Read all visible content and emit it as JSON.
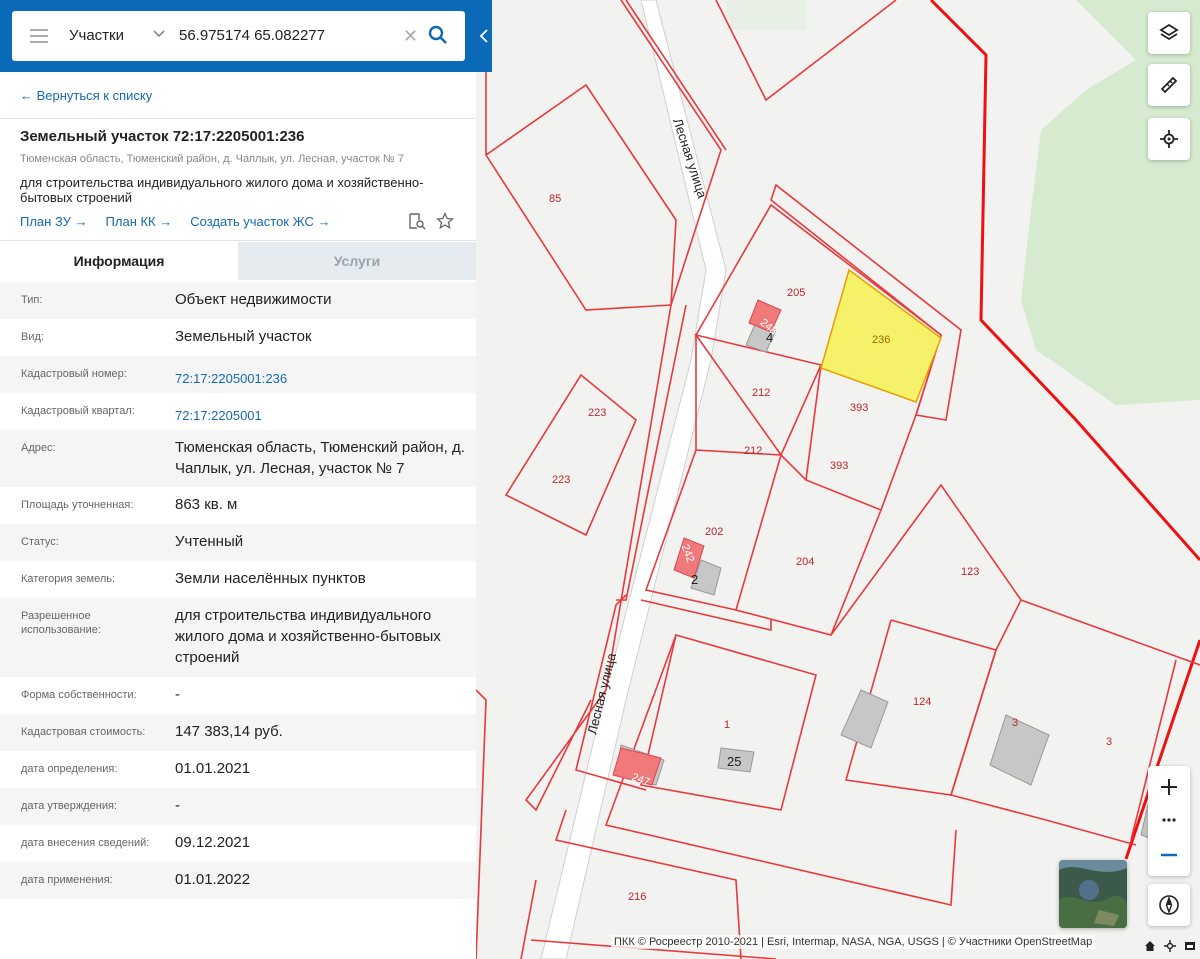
{
  "search": {
    "type_label": "Участки",
    "query": "56.975174 65.082277"
  },
  "nav": {
    "back_label": "← Вернуться к списку"
  },
  "object": {
    "title": "Земельный участок 72:17:2205001:236",
    "address_short": "Тюменская область, Тюменский район, д. Чаплык, ул. Лесная, участок № 7",
    "purpose": "для строительства индивидуального жилого дома и хозяйственно-бытовых строений",
    "links": [
      "План ЗУ →",
      "План КК →",
      "Создать участок ЖС →"
    ]
  },
  "tabs": [
    {
      "label": "Информация",
      "active": true
    },
    {
      "label": "Услуги",
      "active": false
    }
  ],
  "info_rows": [
    {
      "key": "Тип:",
      "value": "Объект недвижимости"
    },
    {
      "key": "Вид:",
      "value": "Земельный участок"
    },
    {
      "key": "Кадастровый номер:",
      "value": "72:17:2205001:236",
      "link": true
    },
    {
      "key": "Кадастровый квартал:",
      "value": "72:17:2205001",
      "link": true
    },
    {
      "key": "Адрес:",
      "value": "Тюменская область, Тюменский район, д. Чаплык, ул. Лесная, участок № 7"
    },
    {
      "key": "Площадь уточненная:",
      "value": "863 кв. м"
    },
    {
      "key": "Статус:",
      "value": "Учтенный"
    },
    {
      "key": "Категория земель:",
      "value": "Земли населённых пунктов"
    },
    {
      "key": "Разрешенное использование:",
      "value": "для строительства индивидуального жилого дома и хозяйственно-бытовых строений"
    },
    {
      "key": "Форма собственности:",
      "value": "-"
    },
    {
      "key": "Кадастровая стоимость:",
      "value": "147 383,14 руб."
    },
    {
      "key": "дата определения:",
      "value": "01.01.2021"
    },
    {
      "key": "дата утверждения:",
      "value": "-"
    },
    {
      "key": "дата внесения сведений:",
      "value": "09.12.2021"
    },
    {
      "key": "дата применения:",
      "value": "01.01.2022"
    }
  ],
  "map": {
    "street_labels": [
      "Лесная улица",
      "Лесная улица"
    ],
    "parcel_labels": [
      "85",
      "205",
      "236",
      "212",
      "393",
      "212",
      "393",
      "223",
      "223",
      "202",
      "204",
      "123",
      "1",
      "124",
      "3",
      "3",
      "216",
      "248",
      "242",
      "247"
    ],
    "building_labels": [
      "4",
      "2",
      "25"
    ],
    "attribution": "ПКК © Росреестр 2010-2021 | Esri, Intermap, NASA, NGA, USGS | © Участники OpenStreetMap",
    "controls": [
      "layers-icon",
      "ruler-icon",
      "locate-icon",
      "zoom-in-icon",
      "more-icon",
      "zoom-out-icon",
      "compass-icon"
    ],
    "colors": {
      "parcel_outline": "#e8393d",
      "selected_fill": "#f5f26a",
      "building_fill": "#c7c7c7",
      "highlight_building": "#f07a7a",
      "forest": "#d8ead2",
      "header": "#0a6ab8"
    }
  }
}
